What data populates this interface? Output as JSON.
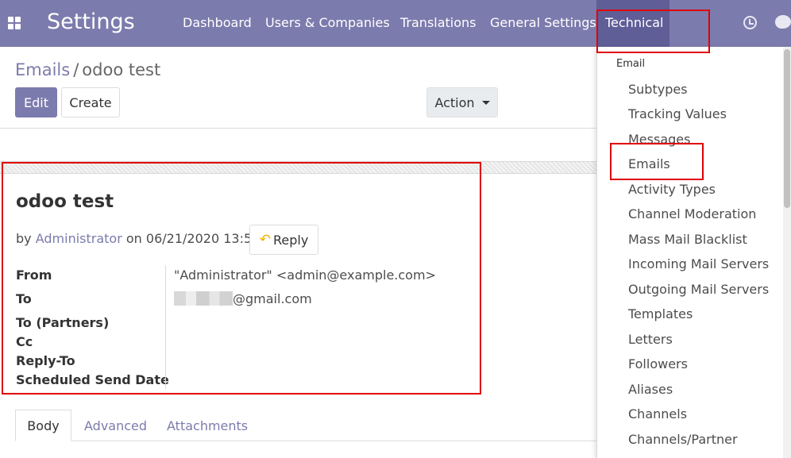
{
  "navbar": {
    "brand": "Settings",
    "items": [
      "Dashboard",
      "Users & Companies",
      "Translations",
      "General Settings"
    ],
    "active": "Technical"
  },
  "breadcrumb": {
    "parent": "Emails",
    "separator": "/",
    "current": "odoo test"
  },
  "buttons": {
    "edit": "Edit",
    "create": "Create",
    "action": "Action",
    "reply": "Reply"
  },
  "message": {
    "subject": "odoo test",
    "by": "by",
    "author": "Administrator",
    "on": "on",
    "date": "06/21/2020 13:57:06",
    "fields": {
      "from_label": "From",
      "from_value": "\"Administrator\" <admin@example.com>",
      "to_label": "To",
      "to_value_suffix": "@gmail.com",
      "to_partners_label": "To (Partners)",
      "cc_label": "Cc",
      "reply_to_label": "Reply-To",
      "scheduled_label": "Scheduled Send Date"
    }
  },
  "tabs": [
    "Body",
    "Advanced",
    "Attachments"
  ],
  "menu": {
    "header": "Email",
    "items": [
      "Subtypes",
      "Tracking Values",
      "Messages",
      "Emails",
      "Activity Types",
      "Channel Moderation",
      "Mass Mail Blacklist",
      "Incoming Mail Servers",
      "Outgoing Mail Servers",
      "Templates",
      "Letters",
      "Followers",
      "Aliases",
      "Channels",
      "Channels/Partner"
    ]
  },
  "colors": {
    "navbar": "#7c7bad",
    "active_nav": "#5f5e97",
    "link": "#7c7bad",
    "highlight": "#e00000"
  }
}
